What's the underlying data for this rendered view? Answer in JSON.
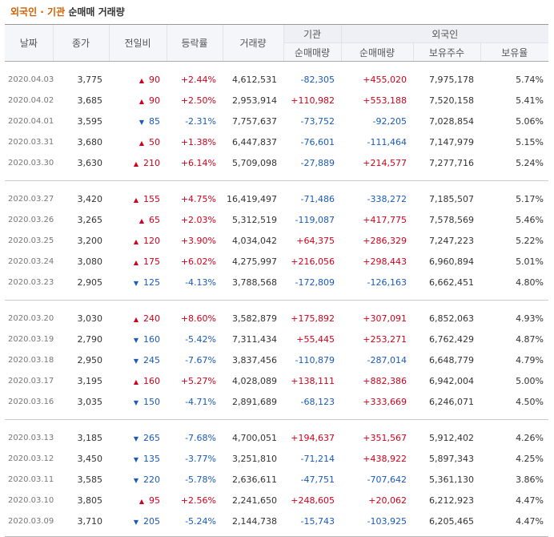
{
  "title": {
    "part1": "외국인 · 기관",
    "part2": "순매매 거래량"
  },
  "headers": {
    "date": "날짜",
    "close": "종가",
    "change": "전일비",
    "rate": "등락률",
    "volume": "거래량",
    "inst": "기관",
    "foreign": "외국인",
    "inst_net": "순매매량",
    "foreign_net": "순매매량",
    "holdings": "보유주수",
    "ratio": "보유율"
  },
  "groups": [
    [
      {
        "date": "2020.04.03",
        "close": "3,775",
        "dir": "up",
        "change": "90",
        "rate": "+2.44%",
        "volume": "4,612,531",
        "inst": "-82,305",
        "foreign": "+455,020",
        "holdings": "7,975,178",
        "ratio": "5.74%"
      },
      {
        "date": "2020.04.02",
        "close": "3,685",
        "dir": "up",
        "change": "90",
        "rate": "+2.50%",
        "volume": "2,953,914",
        "inst": "+110,982",
        "foreign": "+553,188",
        "holdings": "7,520,158",
        "ratio": "5.41%"
      },
      {
        "date": "2020.04.01",
        "close": "3,595",
        "dir": "down",
        "change": "85",
        "rate": "-2.31%",
        "volume": "7,757,637",
        "inst": "-73,752",
        "foreign": "-92,205",
        "holdings": "7,028,854",
        "ratio": "5.06%"
      },
      {
        "date": "2020.03.31",
        "close": "3,680",
        "dir": "up",
        "change": "50",
        "rate": "+1.38%",
        "volume": "6,447,837",
        "inst": "-76,601",
        "foreign": "-111,464",
        "holdings": "7,147,979",
        "ratio": "5.15%"
      },
      {
        "date": "2020.03.30",
        "close": "3,630",
        "dir": "up",
        "change": "210",
        "rate": "+6.14%",
        "volume": "5,709,098",
        "inst": "-27,889",
        "foreign": "+214,577",
        "holdings": "7,277,716",
        "ratio": "5.24%"
      }
    ],
    [
      {
        "date": "2020.03.27",
        "close": "3,420",
        "dir": "up",
        "change": "155",
        "rate": "+4.75%",
        "volume": "16,419,497",
        "inst": "-71,486",
        "foreign": "-338,272",
        "holdings": "7,185,507",
        "ratio": "5.17%"
      },
      {
        "date": "2020.03.26",
        "close": "3,265",
        "dir": "up",
        "change": "65",
        "rate": "+2.03%",
        "volume": "5,312,519",
        "inst": "-119,087",
        "foreign": "+417,775",
        "holdings": "7,578,569",
        "ratio": "5.46%"
      },
      {
        "date": "2020.03.25",
        "close": "3,200",
        "dir": "up",
        "change": "120",
        "rate": "+3.90%",
        "volume": "4,034,042",
        "inst": "+64,375",
        "foreign": "+286,329",
        "holdings": "7,247,223",
        "ratio": "5.22%"
      },
      {
        "date": "2020.03.24",
        "close": "3,080",
        "dir": "up",
        "change": "175",
        "rate": "+6.02%",
        "volume": "4,275,997",
        "inst": "+216,056",
        "foreign": "+298,443",
        "holdings": "6,960,894",
        "ratio": "5.01%"
      },
      {
        "date": "2020.03.23",
        "close": "2,905",
        "dir": "down",
        "change": "125",
        "rate": "-4.13%",
        "volume": "3,788,568",
        "inst": "-172,809",
        "foreign": "-126,163",
        "holdings": "6,662,451",
        "ratio": "4.80%"
      }
    ],
    [
      {
        "date": "2020.03.20",
        "close": "3,030",
        "dir": "up",
        "change": "240",
        "rate": "+8.60%",
        "volume": "3,582,879",
        "inst": "+175,892",
        "foreign": "+307,091",
        "holdings": "6,852,063",
        "ratio": "4.93%"
      },
      {
        "date": "2020.03.19",
        "close": "2,790",
        "dir": "down",
        "change": "160",
        "rate": "-5.42%",
        "volume": "7,311,434",
        "inst": "+55,445",
        "foreign": "+253,271",
        "holdings": "6,762,429",
        "ratio": "4.87%"
      },
      {
        "date": "2020.03.18",
        "close": "2,950",
        "dir": "down",
        "change": "245",
        "rate": "-7.67%",
        "volume": "3,837,456",
        "inst": "-110,879",
        "foreign": "-287,014",
        "holdings": "6,648,779",
        "ratio": "4.79%"
      },
      {
        "date": "2020.03.17",
        "close": "3,195",
        "dir": "up",
        "change": "160",
        "rate": "+5.27%",
        "volume": "4,028,089",
        "inst": "+138,111",
        "foreign": "+882,386",
        "holdings": "6,942,004",
        "ratio": "5.00%"
      },
      {
        "date": "2020.03.16",
        "close": "3,035",
        "dir": "down",
        "change": "150",
        "rate": "-4.71%",
        "volume": "2,891,689",
        "inst": "-68,123",
        "foreign": "+333,669",
        "holdings": "6,246,071",
        "ratio": "4.50%"
      }
    ],
    [
      {
        "date": "2020.03.13",
        "close": "3,185",
        "dir": "down",
        "change": "265",
        "rate": "-7.68%",
        "volume": "4,700,051",
        "inst": "+194,637",
        "foreign": "+351,567",
        "holdings": "5,912,402",
        "ratio": "4.26%"
      },
      {
        "date": "2020.03.12",
        "close": "3,450",
        "dir": "down",
        "change": "135",
        "rate": "-3.77%",
        "volume": "3,251,810",
        "inst": "-71,214",
        "foreign": "+438,922",
        "holdings": "5,897,343",
        "ratio": "4.25%"
      },
      {
        "date": "2020.03.11",
        "close": "3,585",
        "dir": "down",
        "change": "220",
        "rate": "-5.78%",
        "volume": "2,636,611",
        "inst": "-47,751",
        "foreign": "-707,642",
        "holdings": "5,361,130",
        "ratio": "3.86%"
      },
      {
        "date": "2020.03.10",
        "close": "3,805",
        "dir": "up",
        "change": "95",
        "rate": "+2.56%",
        "volume": "2,241,650",
        "inst": "+248,605",
        "foreign": "+20,062",
        "holdings": "6,212,923",
        "ratio": "4.47%"
      },
      {
        "date": "2020.03.09",
        "close": "3,710",
        "dir": "down",
        "change": "205",
        "rate": "-5.24%",
        "volume": "2,144,738",
        "inst": "-15,743",
        "foreign": "-103,925",
        "holdings": "6,205,465",
        "ratio": "4.47%"
      }
    ]
  ],
  "colors": {
    "up": "#d0021b",
    "down": "#1a5bb8",
    "title_accent": "#d45f00"
  },
  "icons": {
    "up": "triangle-up-icon",
    "down": "triangle-down-icon"
  }
}
